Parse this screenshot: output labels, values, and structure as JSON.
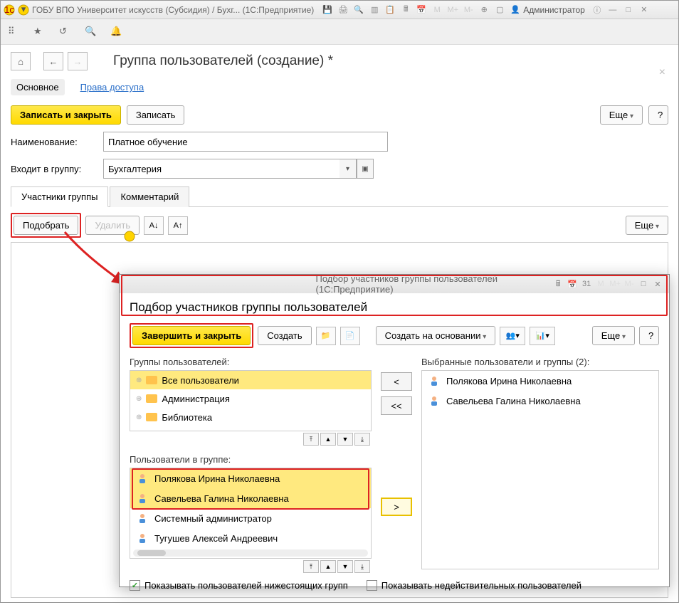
{
  "titlebar": {
    "app_title": "ГОБУ ВПО Университет искусств (Субсидия) / Бухг... (1С:Предприятие)",
    "user": "Администратор"
  },
  "page": {
    "title": "Группа пользователей (создание) *",
    "tabs": {
      "main": "Основное",
      "rights": "Права доступа"
    },
    "save_close": "Записать и закрыть",
    "save": "Записать",
    "more": "Еще",
    "name_label": "Наименование:",
    "name_value": "Платное обучение",
    "group_label": "Входит в группу:",
    "group_value": "Бухгалтерия",
    "inner_tabs": {
      "members": "Участники группы",
      "comment": "Комментарий"
    },
    "pick": "Подобрать",
    "delete": "Удалить"
  },
  "dialog": {
    "wintitle": "Подбор участников группы пользователей  (1С:Предприятие)",
    "heading": "Подбор участников группы пользователей",
    "finish": "Завершить и закрыть",
    "create": "Создать",
    "create_based": "Создать на основании",
    "more": "Еще",
    "groups_label": "Группы пользователей:",
    "groups": [
      "Все пользователи",
      "Администрация",
      "Библиотека"
    ],
    "users_label": "Пользователи в группе:",
    "users": [
      "Полякова Ирина Николаевна",
      "Савельева Галина Николаевна",
      "Системный администратор",
      "Тугушев Алексей Андреевич"
    ],
    "selected_label": "Выбранные пользователи и группы (2):",
    "selected": [
      "Полякова Ирина Николаевна",
      "Савельева Галина Николаевна"
    ],
    "chk1": "Показывать пользователей нижестоящих групп",
    "chk2": "Показывать недействительных пользователей"
  }
}
